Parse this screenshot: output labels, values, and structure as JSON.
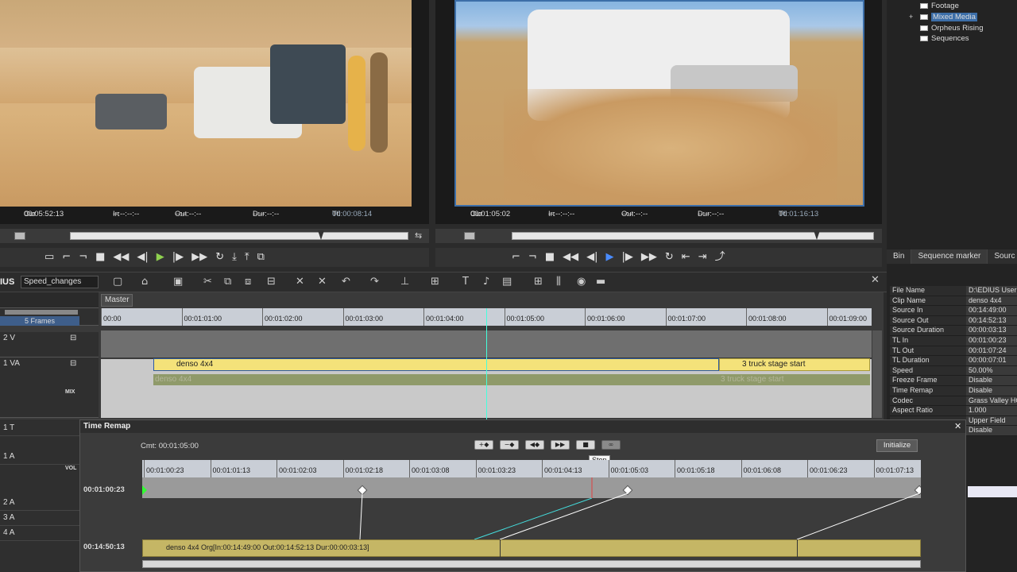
{
  "left_monitor": {
    "cur_label": "Cur",
    "cur": "00:05:52:13",
    "in_label": "In",
    "in": "--:--:--:--",
    "out_label": "Out",
    "out": "--:--:--:--",
    "dur_label": "Dur",
    "dur": "--:--:--:--",
    "ttl_label": "Ttl",
    "ttl": "00:00:08:14"
  },
  "right_monitor": {
    "cur_label": "Cur",
    "cur": "00:01:05:02",
    "in_label": "In",
    "in": "--:--:--:--",
    "out_label": "Out",
    "out": "--:--:--:--",
    "dur_label": "Dur",
    "dur": "--:--:--:--",
    "ttl_label": "Ttl",
    "ttl": "00:01:16:13"
  },
  "bin": {
    "items": [
      {
        "label": "Footage"
      },
      {
        "label": "Mixed Media"
      },
      {
        "label": "Orpheus Rising"
      },
      {
        "label": "Sequences"
      }
    ],
    "tabs": [
      "Bin",
      "Sequence marker",
      "Sourc"
    ]
  },
  "properties": [
    {
      "k": "File Name",
      "v": "D:\\EDIUS User"
    },
    {
      "k": "Clip Name",
      "v": "denso 4x4"
    },
    {
      "k": "Source In",
      "v": "00:14:49:00"
    },
    {
      "k": "Source Out",
      "v": "00:14:52:13"
    },
    {
      "k": "Source Duration",
      "v": "00:00:03:13"
    },
    {
      "k": "TL In",
      "v": "00:01:00:23"
    },
    {
      "k": "TL Out",
      "v": "00:01:07:24"
    },
    {
      "k": "TL Duration",
      "v": "00:00:07:01"
    },
    {
      "k": "Speed",
      "v": "50.00%"
    },
    {
      "k": "Freeze Frame",
      "v": "Disable"
    },
    {
      "k": "Time Remap",
      "v": "Disable"
    },
    {
      "k": "Codec",
      "v": "Grass Valley HQ"
    },
    {
      "k": "Aspect Ratio",
      "v": "1.000"
    },
    {
      "k": "",
      "v": "Upper Field"
    },
    {
      "k": "",
      "v": "Disable"
    }
  ],
  "app": {
    "brand": "IUS",
    "sequence": "Speed_changes",
    "tab": "Master",
    "scale": "5 Frames"
  },
  "timeline": {
    "ticks": [
      "00:00",
      "00:01:01:00",
      "00:01:02:00",
      "00:01:03:00",
      "00:01:04:00",
      "00:01:05:00",
      "00:01:06:00",
      "00:01:07:00",
      "00:01:08:00",
      "00:01:09:00"
    ],
    "tracks": [
      {
        "name": "2 V"
      },
      {
        "name": "1 VA"
      }
    ],
    "mix": "MIX",
    "clip1": "denso 4x4",
    "clip1_ghost": "denso 4x4",
    "clip2": "3 truck stage start",
    "clip2_ghost": "3 truck stage start"
  },
  "lower_tracks": [
    "1 T",
    "1 A",
    "VOL",
    "2 A",
    "3 A",
    "4 A"
  ],
  "time_remap": {
    "title": "Time Remap",
    "cmt_label": "Cmt:",
    "cmt": "00:01:05:00",
    "initialize": "Initialize",
    "tooltip": "Stop",
    "ticks": [
      "00:01:00:23",
      "00:01:01:13",
      "00:01:02:03",
      "00:01:02:18",
      "00:01:03:08",
      "00:01:03:23",
      "00:01:04:13",
      "00:01:05:03",
      "00:01:05:18",
      "00:01:06:08",
      "00:01:06:23",
      "00:01:07:13"
    ],
    "tl_time": "00:01:00:23",
    "src_time": "00:14:50:13",
    "clip_label": "denso 4x4  Org[In:00:14:49:00 Out:00:14:52:13 Dur:00:00:03:13]"
  },
  "colors": {
    "accent": "#3c6ea8",
    "clip": "#f4e27a",
    "play": "#8fd14f",
    "playhead": "#e04040"
  }
}
